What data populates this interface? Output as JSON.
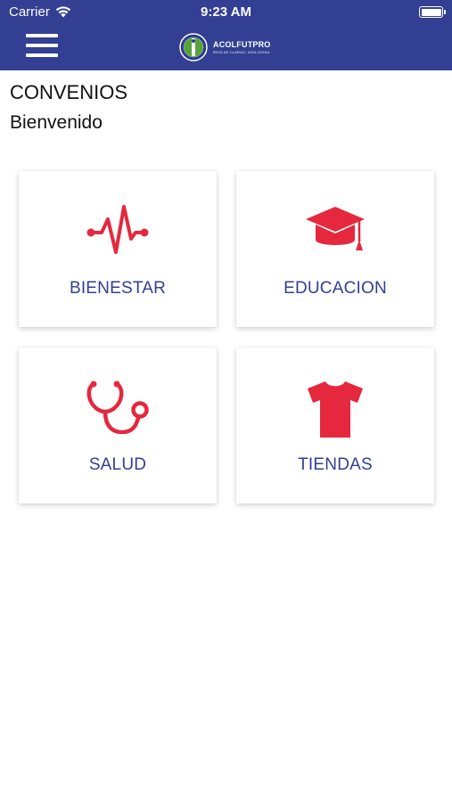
{
  "status_bar": {
    "carrier": "Carrier",
    "time": "9:23 AM"
  },
  "header": {
    "logo_name": "ACOLFUTPRO",
    "logo_slogan": "REGLAS CLARAS, VIDA DIGNA.",
    "background": "#323f93"
  },
  "page": {
    "title": "CONVENIOS",
    "subtitle": "Bienvenido"
  },
  "cards": [
    {
      "label": "BIENESTAR",
      "icon": "heartbeat-icon"
    },
    {
      "label": "EDUCACION",
      "icon": "graduation-cap-icon"
    },
    {
      "label": "SALUD",
      "icon": "stethoscope-icon"
    },
    {
      "label": "TIENDAS",
      "icon": "tshirt-icon"
    }
  ],
  "colors": {
    "accent": "#e5283e",
    "label": "#323f93"
  }
}
